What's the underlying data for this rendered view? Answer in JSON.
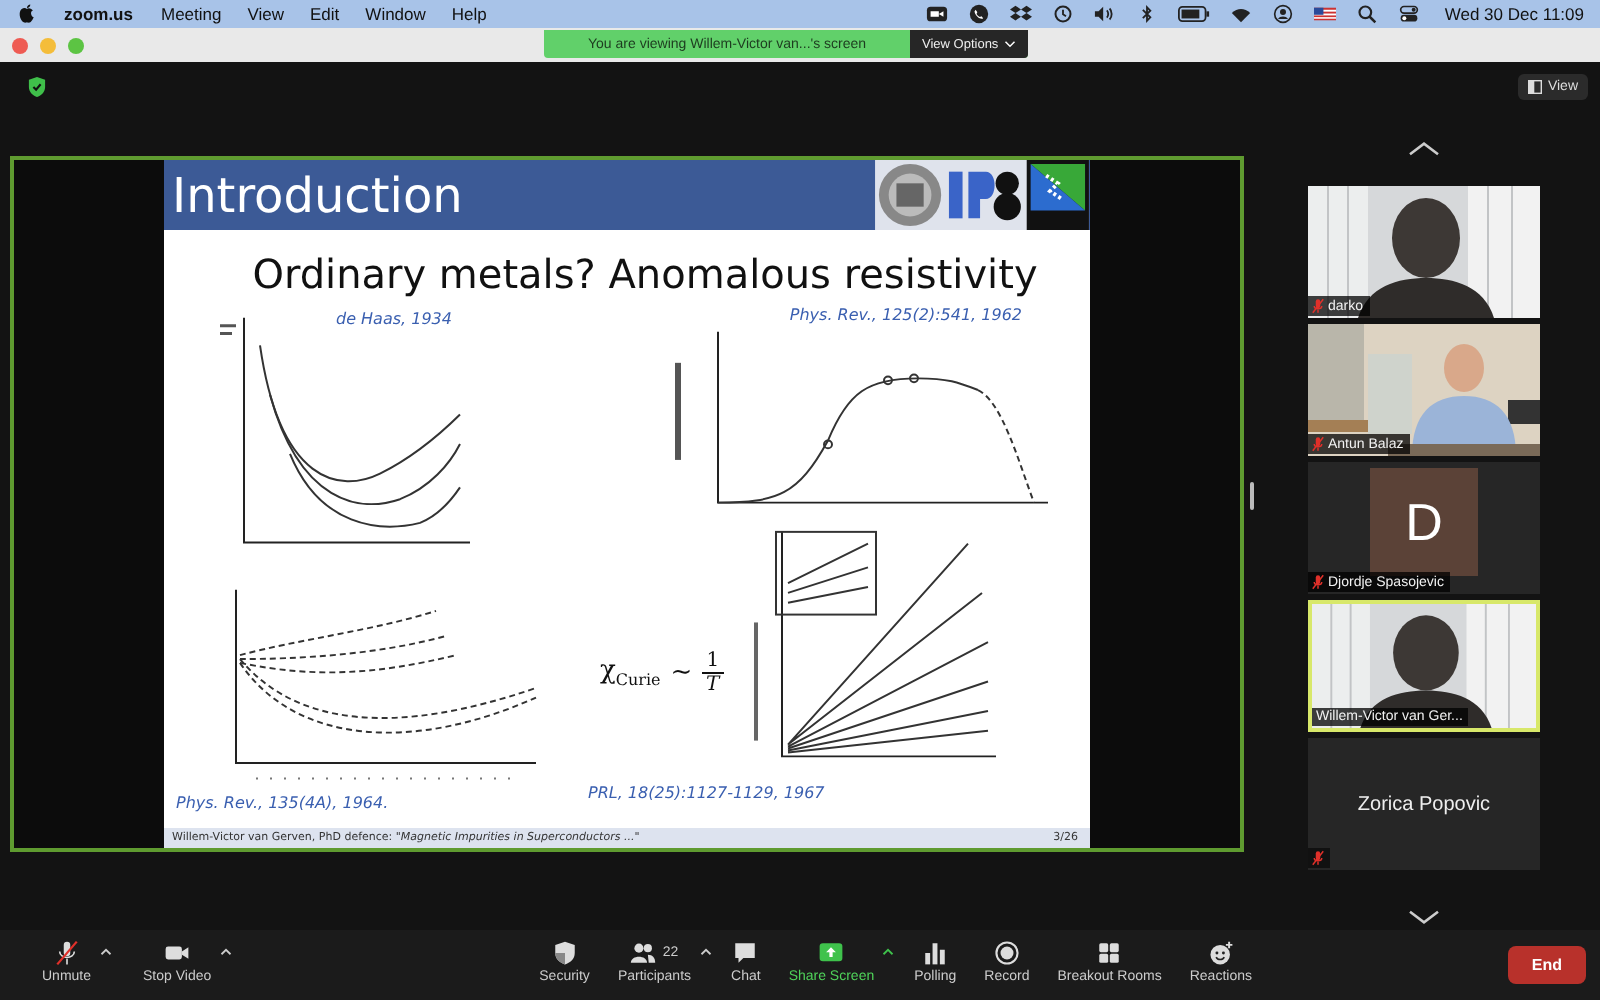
{
  "menubar": {
    "app": "zoom.us",
    "menus": [
      "Meeting",
      "View",
      "Edit",
      "Window",
      "Help"
    ],
    "clock": "Wed 30 Dec  11:09"
  },
  "banner": {
    "text": "You are viewing Willem-Victor van...'s screen",
    "options": "View Options"
  },
  "view_button": "View",
  "slide": {
    "header": "Introduction",
    "title": "Ordinary metals? Anomalous resistivity",
    "overlay_caption": "de Haas, 1934",
    "top_caption": "Phys. Rev., 125(2):541, 1962",
    "formula": {
      "symbol": "χ",
      "subscript": "Curie",
      "relation": "~",
      "numerator": "1",
      "denominator": "T"
    },
    "bottom_captions": [
      "Phys. Rev., 135(4A), 1964.",
      "PRL, 18(25):1127-1129, 1967"
    ],
    "footer": {
      "text": "Willem-Victor van Gerven, PhD defence:  *\"Magnetic Impurities in Superconductors ...\"*",
      "page": "3/26"
    }
  },
  "participants": [
    {
      "kind": "video",
      "name": "darko",
      "muted": true,
      "active": false
    },
    {
      "kind": "video",
      "name": "Antun Balaz",
      "muted": true,
      "active": false
    },
    {
      "kind": "avatar",
      "initial": "D",
      "name": "Djordje Spasojevic",
      "muted": true,
      "active": false
    },
    {
      "kind": "video",
      "name": "Willem-Victor van Ger...",
      "muted": false,
      "active": true
    },
    {
      "kind": "name",
      "name": "Zorica Popovic",
      "muted": true,
      "active": false
    }
  ],
  "toolbar": [
    {
      "kind": "mic-muted",
      "label": "Unmute",
      "caret": true
    },
    {
      "kind": "video",
      "label": "Stop Video",
      "caret": true
    },
    {
      "kind": "security",
      "label": "Security",
      "caret": false
    },
    {
      "kind": "participants",
      "label": "Participants",
      "count": "22",
      "caret": true
    },
    {
      "kind": "chat",
      "label": "Chat",
      "caret": false
    },
    {
      "kind": "share",
      "label": "Share Screen",
      "caret": true
    },
    {
      "kind": "polling",
      "label": "Polling",
      "caret": false
    },
    {
      "kind": "record",
      "label": "Record",
      "caret": false
    },
    {
      "kind": "breakout",
      "label": "Breakout Rooms",
      "caret": false
    },
    {
      "kind": "reactions",
      "label": "Reactions",
      "caret": false
    }
  ],
  "end_button": "End"
}
